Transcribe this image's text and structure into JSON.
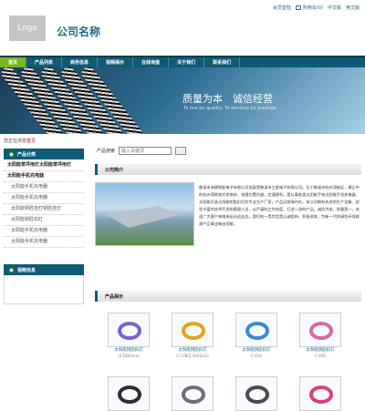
{
  "header": {
    "logo_text": "Logo",
    "company_name": "公司名称",
    "links": [
      "会员登陆",
      "购物车(0)",
      "中文版",
      "英文版"
    ]
  },
  "nav": {
    "items": [
      "首页",
      "产品列表",
      "商务信息",
      "视频展示",
      "在线询盘",
      "关于我们",
      "联系我们"
    ]
  },
  "banner": {
    "headline": "质量为本　诚信经营",
    "tagline": "To live by quality, To develop by prestige"
  },
  "breadcrumb": {
    "prefix": "您正在浏览",
    "current": "首页"
  },
  "sidebar": {
    "category_title": "产品分类",
    "categories": [
      {
        "label": "太阳能草坪用灯太阳能草坪用灯",
        "sub": false
      },
      {
        "label": "太阳能手机充电器",
        "sub": false
      },
      {
        "label": "太阳能手机充电器",
        "sub": true
      },
      {
        "label": "太阳能手机充电器",
        "sub": true
      },
      {
        "label": "太阳能钥匙挂灯钥匙挂灯",
        "sub": true
      },
      {
        "label": "太阳能钥匙扣灯",
        "sub": true
      },
      {
        "label": "太阳能手机充电器",
        "sub": true
      },
      {
        "label": "太阳能手机充电器",
        "sub": true
      }
    ],
    "video_title": "视频信息"
  },
  "search": {
    "label": "产品搜索",
    "placeholder": "输入关键词"
  },
  "intro": {
    "title": "公司简介",
    "text": "慈溪市海捷智能电子有限公司前身是慈溪市三星电子有限公司。位于慈溪市杭州湾新区，建企中的杭州湾跨海大桥南岸，地理位置优越，交通便利。是从事各类太阳能手电太阳能手机充电器、太阳能灯具太阳能钥匙扣灯的专业生产厂家，产品远销海内外。本公司拥有先进的生产设备、经验丰富的技术开发和管理人员，以严谨的工作态度，打造一流的产品。诚信为本，质量第一，欢迎广大客户来电来函洽谈业务。我们的一贯宗旨是以诚相待，积极进取，为新一代的绿色环保能源产品事业做出贡献。"
  },
  "products": {
    "title": "产品展示",
    "items": [
      {
        "label": "太阳能钥匙扣灯",
        "code": "(2.5X45cm)",
        "color": "#7a5fd8"
      },
      {
        "label": "太阳能钥匙扣灯",
        "code": "C-178(2.5X41cm)",
        "color": "#e6a11c"
      },
      {
        "label": "太阳能钥匙扣灯",
        "code": "C-414",
        "color": "#3a87d7"
      },
      {
        "label": "太阳能钥匙扣灯",
        "code": "C-400",
        "color": "#d86aa0"
      },
      {
        "label": "",
        "code": "",
        "color": "#2d2d2d"
      },
      {
        "label": "",
        "code": "",
        "color": "#6f6f6f"
      },
      {
        "label": "",
        "code": "",
        "color": "#4a4a4a"
      },
      {
        "label": "",
        "code": "",
        "color": "#d9407a"
      }
    ]
  },
  "colors": {
    "nav_bg": "#0f5a75",
    "nav_active": "#7ab51d",
    "link": "#1e6b86"
  }
}
